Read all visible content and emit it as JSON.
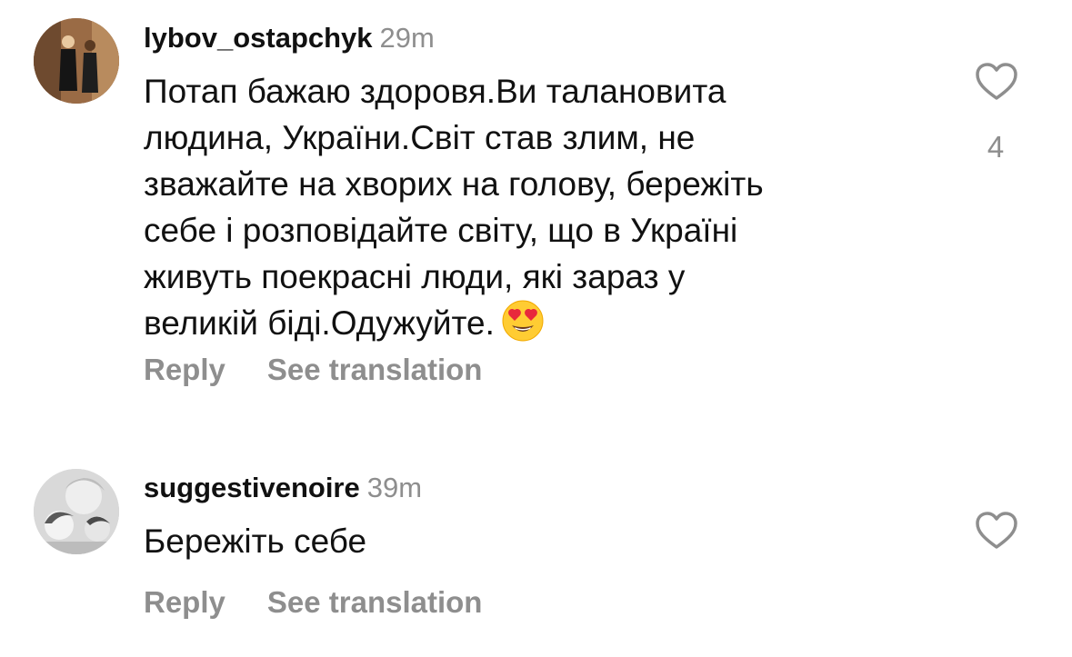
{
  "comments": [
    {
      "username": "lybov_ostapchyk",
      "time": "29m",
      "text_lines": [
        "Потап бажаю здоровя.Ви талановита",
        "людина, України.Світ став злим, не",
        "зважайте на хворих на голову, бережіть",
        "себе і розповідайте світу, що в Україні",
        "живуть поекрасні люди, які зараз у",
        "великій біді.Одужуйте."
      ],
      "emoji": "smiling-face-with-heart-eyes",
      "like_count": "4",
      "reply_label": "Reply",
      "translate_label": "See translation"
    },
    {
      "username": "suggestivenoire",
      "time": "39m",
      "text_lines": [
        "Бережіть себе"
      ],
      "reply_label": "Reply",
      "translate_label": "See translation"
    }
  ],
  "icons": {
    "like": "heart-outline-icon"
  },
  "colors": {
    "text": "#111111",
    "secondary": "#8e8e8e",
    "background": "#ffffff"
  }
}
